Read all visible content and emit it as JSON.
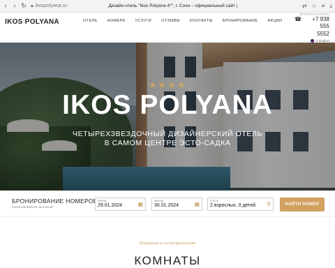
{
  "browser": {
    "url": "ikospolyana.ru",
    "tab_title": "Дизайн-отель \"Ikos Polyana 4*\", г. Сочи – официальный сайт |"
  },
  "header": {
    "logo": "IKOS POLYANA",
    "nav": [
      "ОТЕЛЬ",
      "НОМЕРА",
      "УСЛУГИ",
      "ОТЗЫВЫ",
      "КОНТАКТЫ",
      "БРОНИРОВАНИЕ",
      "АКЦИИ"
    ],
    "hours": "КРУГЛОСУТОЧНО",
    "phone_line1": "+7 938 555",
    "phone_line2": "5552",
    "lang": "to English"
  },
  "hero": {
    "stars": "★★★★",
    "title": "IKOS POLYANA",
    "subtitle_line1": "ЧЕТЫРЕХЗВЕЗДОЧНЫЙ ДИЗАЙНЕРСКИЙ ОТЕЛЬ",
    "subtitle_line2": "В САМОМ ЦЕНТРЕ ЭСТО-САДКА"
  },
  "booking": {
    "title": "БРОНИРОВАНИЕ НОМЕРОВ",
    "note": "Гарантированное заселение",
    "checkin_label": "Заезд",
    "checkin_value": "29.01.2024",
    "checkout_label": "Выезд",
    "checkout_value": "30.01.2024",
    "guests_label": "Гости",
    "guests_value": "2 взрослых, 0 детей",
    "search_label": "НАЙТИ НОМЕР"
  },
  "rooms": {
    "subtitle": "Интерьер и гостеприимство",
    "title": "КОМНАТЫ"
  }
}
